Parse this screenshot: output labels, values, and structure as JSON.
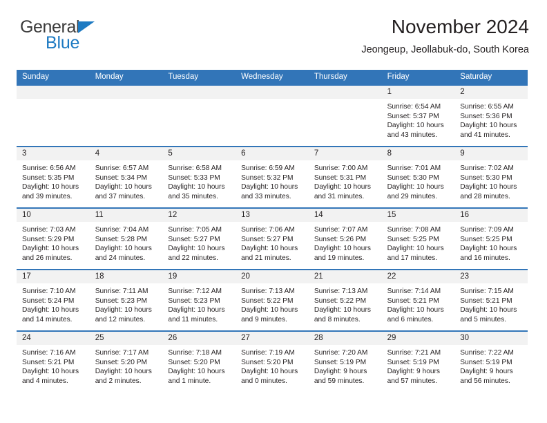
{
  "brand": {
    "name_top": "General",
    "name_bottom": "Blue",
    "color_text": "#3b3b3b",
    "color_accent": "#1d7ac2"
  },
  "header": {
    "title": "November 2024",
    "subtitle": "Jeongeup, Jeollabuk-do, South Korea"
  },
  "theme": {
    "header_blue": "#3275b8",
    "row_strip_gray": "#f2f2f2",
    "text": "#231f20"
  },
  "calendar": {
    "weekdays": [
      "Sunday",
      "Monday",
      "Tuesday",
      "Wednesday",
      "Thursday",
      "Friday",
      "Saturday"
    ],
    "weeks": [
      [
        {
          "day": "",
          "sunrise": "",
          "sunset": "",
          "daylight": "",
          "empty": true
        },
        {
          "day": "",
          "sunrise": "",
          "sunset": "",
          "daylight": "",
          "empty": true
        },
        {
          "day": "",
          "sunrise": "",
          "sunset": "",
          "daylight": "",
          "empty": true
        },
        {
          "day": "",
          "sunrise": "",
          "sunset": "",
          "daylight": "",
          "empty": true
        },
        {
          "day": "",
          "sunrise": "",
          "sunset": "",
          "daylight": "",
          "empty": true
        },
        {
          "day": "1",
          "sunrise": "Sunrise: 6:54 AM",
          "sunset": "Sunset: 5:37 PM",
          "daylight": "Daylight: 10 hours and 43 minutes."
        },
        {
          "day": "2",
          "sunrise": "Sunrise: 6:55 AM",
          "sunset": "Sunset: 5:36 PM",
          "daylight": "Daylight: 10 hours and 41 minutes."
        }
      ],
      [
        {
          "day": "3",
          "sunrise": "Sunrise: 6:56 AM",
          "sunset": "Sunset: 5:35 PM",
          "daylight": "Daylight: 10 hours and 39 minutes."
        },
        {
          "day": "4",
          "sunrise": "Sunrise: 6:57 AM",
          "sunset": "Sunset: 5:34 PM",
          "daylight": "Daylight: 10 hours and 37 minutes."
        },
        {
          "day": "5",
          "sunrise": "Sunrise: 6:58 AM",
          "sunset": "Sunset: 5:33 PM",
          "daylight": "Daylight: 10 hours and 35 minutes."
        },
        {
          "day": "6",
          "sunrise": "Sunrise: 6:59 AM",
          "sunset": "Sunset: 5:32 PM",
          "daylight": "Daylight: 10 hours and 33 minutes."
        },
        {
          "day": "7",
          "sunrise": "Sunrise: 7:00 AM",
          "sunset": "Sunset: 5:31 PM",
          "daylight": "Daylight: 10 hours and 31 minutes."
        },
        {
          "day": "8",
          "sunrise": "Sunrise: 7:01 AM",
          "sunset": "Sunset: 5:30 PM",
          "daylight": "Daylight: 10 hours and 29 minutes."
        },
        {
          "day": "9",
          "sunrise": "Sunrise: 7:02 AM",
          "sunset": "Sunset: 5:30 PM",
          "daylight": "Daylight: 10 hours and 28 minutes."
        }
      ],
      [
        {
          "day": "10",
          "sunrise": "Sunrise: 7:03 AM",
          "sunset": "Sunset: 5:29 PM",
          "daylight": "Daylight: 10 hours and 26 minutes."
        },
        {
          "day": "11",
          "sunrise": "Sunrise: 7:04 AM",
          "sunset": "Sunset: 5:28 PM",
          "daylight": "Daylight: 10 hours and 24 minutes."
        },
        {
          "day": "12",
          "sunrise": "Sunrise: 7:05 AM",
          "sunset": "Sunset: 5:27 PM",
          "daylight": "Daylight: 10 hours and 22 minutes."
        },
        {
          "day": "13",
          "sunrise": "Sunrise: 7:06 AM",
          "sunset": "Sunset: 5:27 PM",
          "daylight": "Daylight: 10 hours and 21 minutes."
        },
        {
          "day": "14",
          "sunrise": "Sunrise: 7:07 AM",
          "sunset": "Sunset: 5:26 PM",
          "daylight": "Daylight: 10 hours and 19 minutes."
        },
        {
          "day": "15",
          "sunrise": "Sunrise: 7:08 AM",
          "sunset": "Sunset: 5:25 PM",
          "daylight": "Daylight: 10 hours and 17 minutes."
        },
        {
          "day": "16",
          "sunrise": "Sunrise: 7:09 AM",
          "sunset": "Sunset: 5:25 PM",
          "daylight": "Daylight: 10 hours and 16 minutes."
        }
      ],
      [
        {
          "day": "17",
          "sunrise": "Sunrise: 7:10 AM",
          "sunset": "Sunset: 5:24 PM",
          "daylight": "Daylight: 10 hours and 14 minutes."
        },
        {
          "day": "18",
          "sunrise": "Sunrise: 7:11 AM",
          "sunset": "Sunset: 5:23 PM",
          "daylight": "Daylight: 10 hours and 12 minutes."
        },
        {
          "day": "19",
          "sunrise": "Sunrise: 7:12 AM",
          "sunset": "Sunset: 5:23 PM",
          "daylight": "Daylight: 10 hours and 11 minutes."
        },
        {
          "day": "20",
          "sunrise": "Sunrise: 7:13 AM",
          "sunset": "Sunset: 5:22 PM",
          "daylight": "Daylight: 10 hours and 9 minutes."
        },
        {
          "day": "21",
          "sunrise": "Sunrise: 7:13 AM",
          "sunset": "Sunset: 5:22 PM",
          "daylight": "Daylight: 10 hours and 8 minutes."
        },
        {
          "day": "22",
          "sunrise": "Sunrise: 7:14 AM",
          "sunset": "Sunset: 5:21 PM",
          "daylight": "Daylight: 10 hours and 6 minutes."
        },
        {
          "day": "23",
          "sunrise": "Sunrise: 7:15 AM",
          "sunset": "Sunset: 5:21 PM",
          "daylight": "Daylight: 10 hours and 5 minutes."
        }
      ],
      [
        {
          "day": "24",
          "sunrise": "Sunrise: 7:16 AM",
          "sunset": "Sunset: 5:21 PM",
          "daylight": "Daylight: 10 hours and 4 minutes."
        },
        {
          "day": "25",
          "sunrise": "Sunrise: 7:17 AM",
          "sunset": "Sunset: 5:20 PM",
          "daylight": "Daylight: 10 hours and 2 minutes."
        },
        {
          "day": "26",
          "sunrise": "Sunrise: 7:18 AM",
          "sunset": "Sunset: 5:20 PM",
          "daylight": "Daylight: 10 hours and 1 minute."
        },
        {
          "day": "27",
          "sunrise": "Sunrise: 7:19 AM",
          "sunset": "Sunset: 5:20 PM",
          "daylight": "Daylight: 10 hours and 0 minutes."
        },
        {
          "day": "28",
          "sunrise": "Sunrise: 7:20 AM",
          "sunset": "Sunset: 5:19 PM",
          "daylight": "Daylight: 9 hours and 59 minutes."
        },
        {
          "day": "29",
          "sunrise": "Sunrise: 7:21 AM",
          "sunset": "Sunset: 5:19 PM",
          "daylight": "Daylight: 9 hours and 57 minutes."
        },
        {
          "day": "30",
          "sunrise": "Sunrise: 7:22 AM",
          "sunset": "Sunset: 5:19 PM",
          "daylight": "Daylight: 9 hours and 56 minutes."
        }
      ]
    ]
  }
}
